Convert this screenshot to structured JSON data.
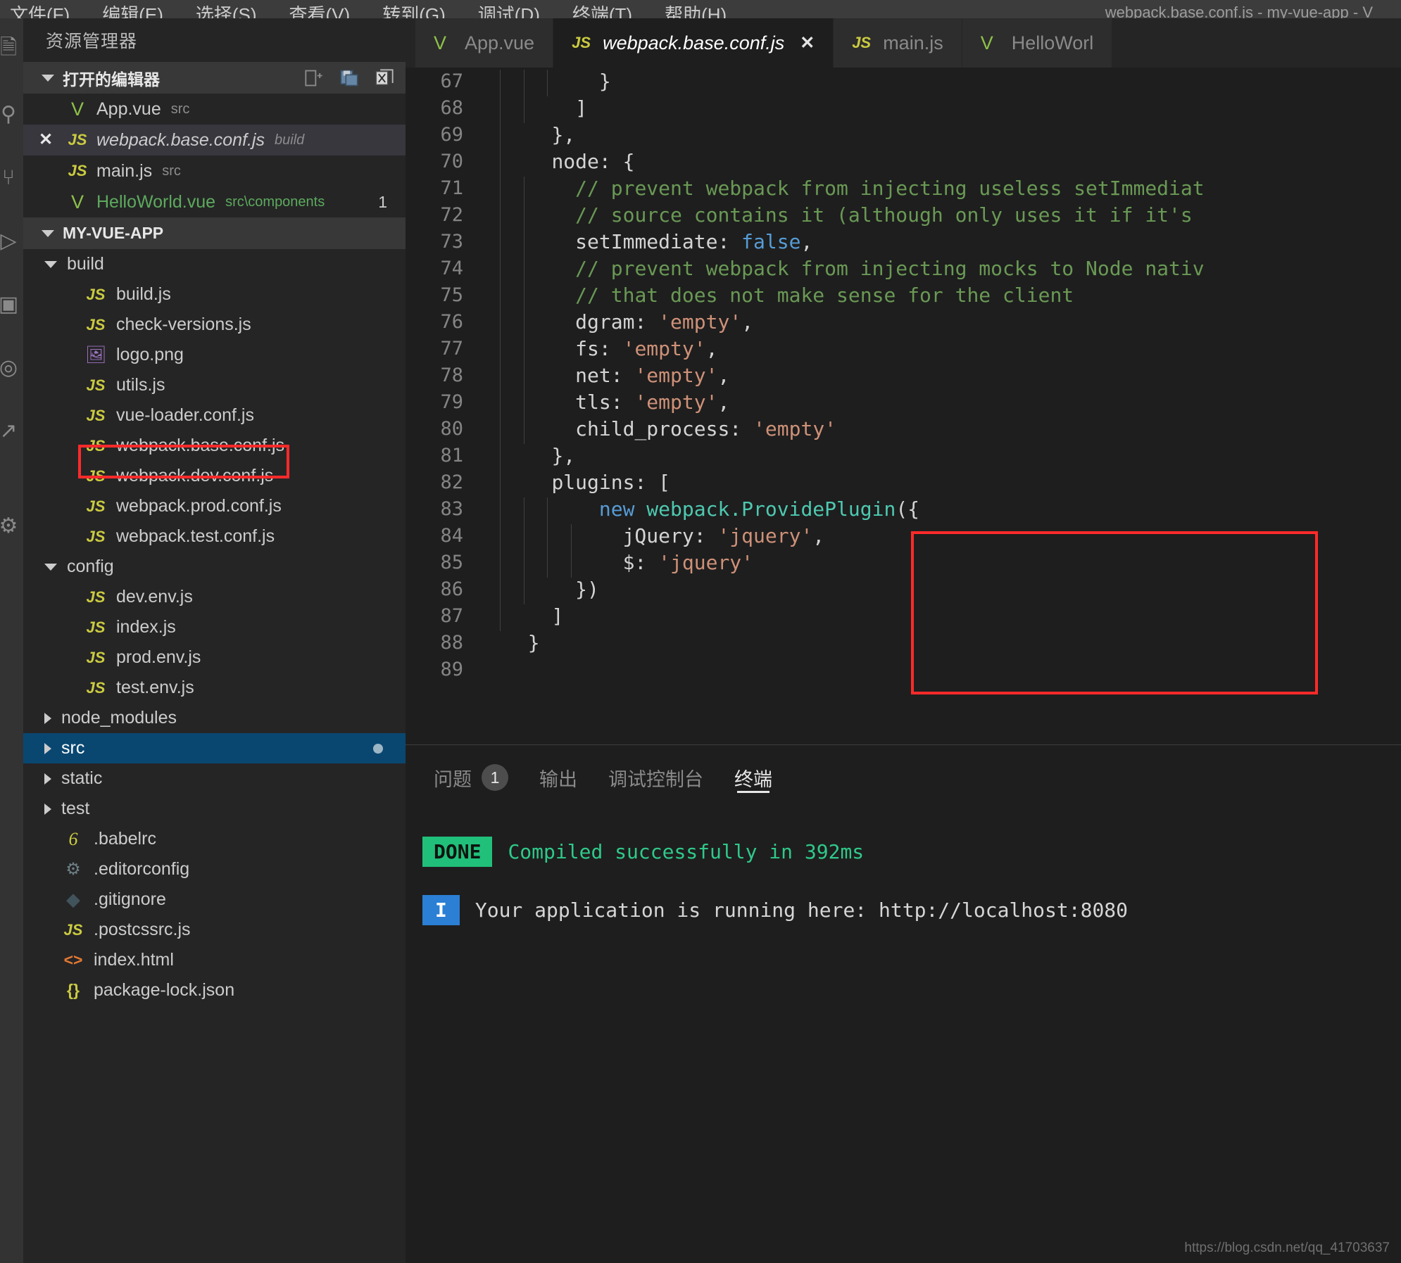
{
  "window": {
    "title": "webpack.base.conf.js - my-vue-app - V",
    "menu": [
      "文件(F)",
      "编辑(E)",
      "选择(S)",
      "查看(V)",
      "转到(G)",
      "调试(D)",
      "终端(T)",
      "帮助(H)"
    ]
  },
  "activity_bar": {
    "icons": [
      "explorer-icon",
      "search-icon",
      "source-control-icon",
      "debug-icon",
      "extensions-icon",
      "test-icon",
      "remote-icon",
      "account-icon"
    ]
  },
  "sidebar": {
    "title": "资源管理器",
    "open_editors": {
      "label": "打开的编辑器",
      "actions": [
        "new-file-icon",
        "save-all-icon",
        "close-all-icon"
      ],
      "items": [
        {
          "icon": "vue-file-icon",
          "name": "App.vue",
          "desc": "src",
          "state": "open"
        },
        {
          "icon": "js-file-icon",
          "name": "webpack.base.conf.js",
          "desc": "build",
          "state": "active"
        },
        {
          "icon": "js-file-icon",
          "name": "main.js",
          "desc": "src",
          "state": "open"
        },
        {
          "icon": "vue-file-icon",
          "name": "HelloWorld.vue",
          "desc": "src\\components",
          "state": "modified",
          "badge": "1"
        }
      ]
    },
    "project": {
      "label": "MY-VUE-APP",
      "tree": [
        {
          "icon": "folder-open-icon",
          "name": "build",
          "type": "folder",
          "expanded": true,
          "depth": 1
        },
        {
          "icon": "js-file-icon",
          "name": "build.js",
          "type": "file",
          "depth": 2
        },
        {
          "icon": "js-file-icon",
          "name": "check-versions.js",
          "type": "file",
          "depth": 2
        },
        {
          "icon": "image-file-icon",
          "name": "logo.png",
          "type": "file",
          "depth": 2
        },
        {
          "icon": "js-file-icon",
          "name": "utils.js",
          "type": "file",
          "depth": 2
        },
        {
          "icon": "js-file-icon",
          "name": "vue-loader.conf.js",
          "type": "file",
          "depth": 2
        },
        {
          "icon": "js-file-icon",
          "name": "webpack.base.conf.js",
          "type": "file",
          "depth": 2,
          "highlighted": true
        },
        {
          "icon": "js-file-icon",
          "name": "webpack.dev.conf.js",
          "type": "file",
          "depth": 2
        },
        {
          "icon": "js-file-icon",
          "name": "webpack.prod.conf.js",
          "type": "file",
          "depth": 2
        },
        {
          "icon": "js-file-icon",
          "name": "webpack.test.conf.js",
          "type": "file",
          "depth": 2
        },
        {
          "icon": "folder-open-icon",
          "name": "config",
          "type": "folder",
          "expanded": true,
          "depth": 1
        },
        {
          "icon": "js-file-icon",
          "name": "dev.env.js",
          "type": "file",
          "depth": 2
        },
        {
          "icon": "js-file-icon",
          "name": "index.js",
          "type": "file",
          "depth": 2
        },
        {
          "icon": "js-file-icon",
          "name": "prod.env.js",
          "type": "file",
          "depth": 2
        },
        {
          "icon": "js-file-icon",
          "name": "test.env.js",
          "type": "file",
          "depth": 2
        },
        {
          "icon": "folder-closed-icon",
          "name": "node_modules",
          "type": "folder",
          "expanded": false,
          "depth": 1
        },
        {
          "icon": "folder-closed-icon",
          "name": "src",
          "type": "folder",
          "expanded": false,
          "depth": 1,
          "selected": true,
          "dot": true
        },
        {
          "icon": "folder-closed-icon",
          "name": "static",
          "type": "folder",
          "expanded": false,
          "depth": 1
        },
        {
          "icon": "folder-closed-icon",
          "name": "test",
          "type": "folder",
          "expanded": false,
          "depth": 1
        },
        {
          "icon": "babel-file-icon",
          "name": ".babelrc",
          "type": "file",
          "depth": 1
        },
        {
          "icon": "gear-file-icon",
          "name": ".editorconfig",
          "type": "file",
          "depth": 1
        },
        {
          "icon": "git-file-icon",
          "name": ".gitignore",
          "type": "file",
          "depth": 1
        },
        {
          "icon": "js-file-icon",
          "name": ".postcssrc.js",
          "type": "file",
          "depth": 1
        },
        {
          "icon": "html-file-icon",
          "name": "index.html",
          "type": "file",
          "depth": 1
        },
        {
          "icon": "json-file-icon",
          "name": "package-lock.json",
          "type": "file",
          "depth": 1
        }
      ]
    }
  },
  "tabs": [
    {
      "icon": "vue-file-icon",
      "label": "App.vue",
      "active": false,
      "closable": false
    },
    {
      "icon": "js-file-icon",
      "label": "webpack.base.conf.js",
      "active": true,
      "closable": true,
      "close_label": "✕"
    },
    {
      "icon": "js-file-icon",
      "label": "main.js",
      "active": false,
      "closable": false
    },
    {
      "icon": "vue-file-icon",
      "label": "HelloWorl",
      "active": false,
      "closable": false
    }
  ],
  "editor": {
    "file": "webpack.base.conf.js",
    "first_line": 67,
    "highlight_box": "plugins block lines 82-87",
    "lines": [
      {
        "n": 67,
        "indent": 4,
        "tokens": [
          {
            "t": "}",
            "c": "def"
          }
        ]
      },
      {
        "n": 68,
        "indent": 3,
        "tokens": [
          {
            "t": "]",
            "c": "def"
          }
        ]
      },
      {
        "n": 69,
        "indent": 2,
        "tokens": [
          {
            "t": "},",
            "c": "def"
          }
        ]
      },
      {
        "n": 70,
        "indent": 2,
        "tokens": [
          {
            "t": "node: {",
            "c": "def"
          }
        ]
      },
      {
        "n": 71,
        "indent": 3,
        "tokens": [
          {
            "t": "// prevent webpack from injecting useless setImmediat",
            "c": "com"
          }
        ]
      },
      {
        "n": 72,
        "indent": 3,
        "tokens": [
          {
            "t": "// source contains it (although only uses it if it's",
            "c": "com"
          }
        ]
      },
      {
        "n": 73,
        "indent": 3,
        "tokens": [
          {
            "t": "setImmediate: ",
            "c": "def"
          },
          {
            "t": "false",
            "c": "kw"
          },
          {
            "t": ",",
            "c": "def"
          }
        ]
      },
      {
        "n": 74,
        "indent": 3,
        "tokens": [
          {
            "t": "// prevent webpack from injecting mocks to Node nativ",
            "c": "com"
          }
        ]
      },
      {
        "n": 75,
        "indent": 3,
        "tokens": [
          {
            "t": "// that does not make sense for the client",
            "c": "com"
          }
        ]
      },
      {
        "n": 76,
        "indent": 3,
        "tokens": [
          {
            "t": "dgram: ",
            "c": "def"
          },
          {
            "t": "'empty'",
            "c": "str"
          },
          {
            "t": ",",
            "c": "def"
          }
        ]
      },
      {
        "n": 77,
        "indent": 3,
        "tokens": [
          {
            "t": "fs: ",
            "c": "def"
          },
          {
            "t": "'empty'",
            "c": "str"
          },
          {
            "t": ",",
            "c": "def"
          }
        ]
      },
      {
        "n": 78,
        "indent": 3,
        "tokens": [
          {
            "t": "net: ",
            "c": "def"
          },
          {
            "t": "'empty'",
            "c": "str"
          },
          {
            "t": ",",
            "c": "def"
          }
        ]
      },
      {
        "n": 79,
        "indent": 3,
        "tokens": [
          {
            "t": "tls: ",
            "c": "def"
          },
          {
            "t": "'empty'",
            "c": "str"
          },
          {
            "t": ",",
            "c": "def"
          }
        ]
      },
      {
        "n": 80,
        "indent": 3,
        "tokens": [
          {
            "t": "child_process: ",
            "c": "def"
          },
          {
            "t": "'empty'",
            "c": "str"
          }
        ]
      },
      {
        "n": 81,
        "indent": 2,
        "tokens": [
          {
            "t": "},",
            "c": "def"
          }
        ]
      },
      {
        "n": 82,
        "indent": 2,
        "tokens": [
          {
            "t": "plugins: [",
            "c": "def"
          }
        ]
      },
      {
        "n": 83,
        "indent": 4,
        "tokens": [
          {
            "t": "new ",
            "c": "kw"
          },
          {
            "t": "webpack.ProvidePlugin",
            "c": "cls"
          },
          {
            "t": "({",
            "c": "def"
          }
        ]
      },
      {
        "n": 84,
        "indent": 5,
        "tokens": [
          {
            "t": "jQuery: ",
            "c": "def"
          },
          {
            "t": "'jquery'",
            "c": "str"
          },
          {
            "t": ",",
            "c": "def"
          }
        ]
      },
      {
        "n": 85,
        "indent": 5,
        "tokens": [
          {
            "t": "$: ",
            "c": "def"
          },
          {
            "t": "'jquery'",
            "c": "str"
          }
        ]
      },
      {
        "n": 86,
        "indent": 3,
        "tokens": [
          {
            "t": "})",
            "c": "def"
          }
        ]
      },
      {
        "n": 87,
        "indent": 2,
        "tokens": [
          {
            "t": "]",
            "c": "def"
          }
        ]
      },
      {
        "n": 88,
        "indent": 1,
        "tokens": [
          {
            "t": "}",
            "c": "def"
          }
        ]
      },
      {
        "n": 89,
        "indent": 1,
        "tokens": [
          {
            "t": "",
            "c": "def"
          }
        ]
      }
    ]
  },
  "panel": {
    "tabs": [
      {
        "label": "问题",
        "count": "1",
        "active": false
      },
      {
        "label": "输出",
        "count": "",
        "active": false
      },
      {
        "label": "调试控制台",
        "count": "",
        "active": false
      },
      {
        "label": "终端",
        "count": "",
        "active": true
      }
    ],
    "terminal": [
      {
        "tag": "DONE",
        "tag_color": "#21c07a",
        "text": "Compiled successfully in 392ms",
        "text_color": "#2fc98a"
      },
      {
        "tag": "I",
        "tag_color": "#2b7fd4",
        "text": "Your application is running here: http://localhost:8080",
        "text_color": "#d6d6d6"
      }
    ]
  },
  "watermark": "https://blog.csdn.net/qq_41703637"
}
